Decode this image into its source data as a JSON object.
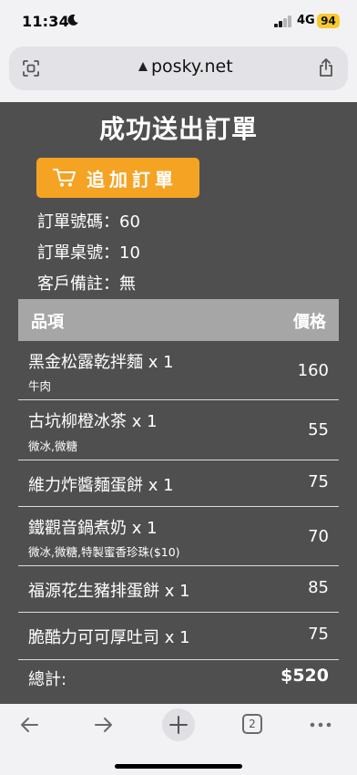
{
  "status_bar": {
    "time": "11:34",
    "network": "4G",
    "battery": "94"
  },
  "browser": {
    "url": "posky.net"
  },
  "page": {
    "title": "成功送出訂單",
    "add_order_button": "追加訂單",
    "order_info": [
      {
        "label": "訂單號碼：60"
      },
      {
        "label": "訂單桌號：10"
      },
      {
        "label": "客戶備註：無"
      }
    ],
    "table": {
      "headers": {
        "item": "品項",
        "price": "價格"
      },
      "rows": [
        {
          "name": "黑金松露乾拌麵 x 1",
          "options": "牛肉",
          "price": "160"
        },
        {
          "name": "古坑柳橙冰茶 x 1",
          "options": "微冰,微糖",
          "price": "55"
        },
        {
          "name": "維力炸醬麵蛋餅 x 1",
          "options": "",
          "price": "75"
        },
        {
          "name": "鐵觀音鍋煮奶 x 1",
          "options": "微冰,微糖,特製蜜香珍珠($10)",
          "price": "70"
        },
        {
          "name": "福源花生豬排蛋餅 x 1",
          "options": "",
          "price": "85"
        },
        {
          "name": "脆酷力可可厚吐司 x 1",
          "options": "",
          "price": "75"
        }
      ],
      "total_label": "總計:",
      "total_value": "$520"
    }
  },
  "toolbar": {
    "tab_count": "2"
  },
  "colors": {
    "page_bg": "#4f4f4f",
    "accent": "#f5a323",
    "header_bg": "#a6a6a6"
  }
}
